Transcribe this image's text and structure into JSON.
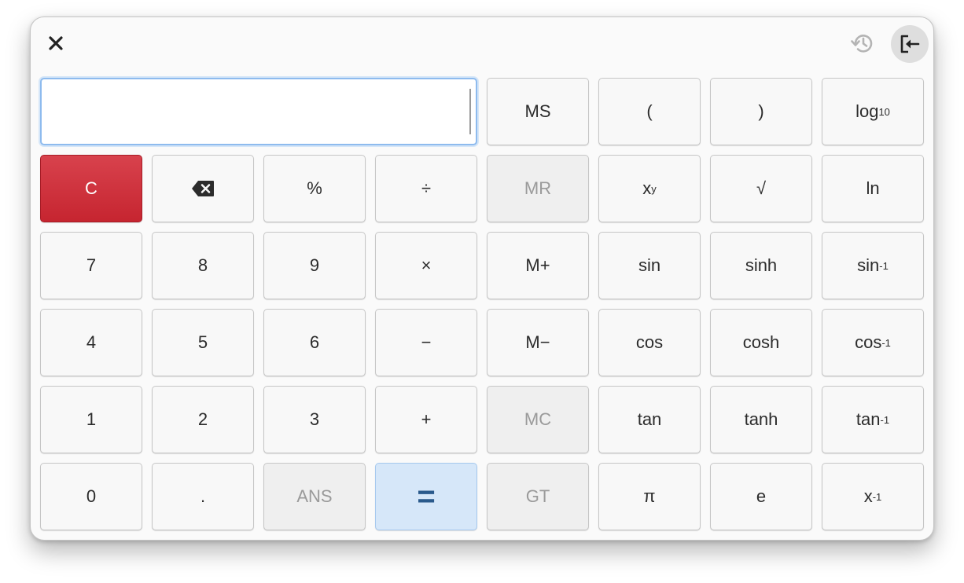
{
  "header": {
    "close_icon": "close-icon",
    "history_icon": "history-icon",
    "mode_icon": "exit-to-left-icon"
  },
  "display": {
    "value": ""
  },
  "keys": {
    "ms": "MS",
    "paren_open": "(",
    "paren_close": ")",
    "log_base": "log",
    "log_sub": "10",
    "clear": "C",
    "backspace_icon": "backspace-icon",
    "percent": "%",
    "divide": "÷",
    "mr": "MR",
    "power_base": "x",
    "power_sup": "y",
    "sqrt": "√",
    "ln": "ln",
    "seven": "7",
    "eight": "8",
    "nine": "9",
    "multiply": "×",
    "m_plus": "M+",
    "sin": "sin",
    "sinh": "sinh",
    "asin_base": "sin",
    "asin_sup": "-1",
    "four": "4",
    "five": "5",
    "six": "6",
    "minus": "−",
    "m_minus": "M−",
    "cos": "cos",
    "cosh": "cosh",
    "acos_base": "cos",
    "acos_sup": "-1",
    "one": "1",
    "two": "2",
    "three": "3",
    "plus": "+",
    "mc": "MC",
    "tan": "tan",
    "tanh": "tanh",
    "atan_base": "tan",
    "atan_sup": "-1",
    "zero": "0",
    "decimal": ".",
    "ans": "ANS",
    "equals": "=",
    "gt": "GT",
    "pi": "π",
    "e": "e",
    "inverse_base": "x",
    "inverse_sup": "-1"
  },
  "colors": {
    "danger": "#c62530",
    "suggested": "#d6e7f9",
    "accent_border": "#8ebbee"
  }
}
